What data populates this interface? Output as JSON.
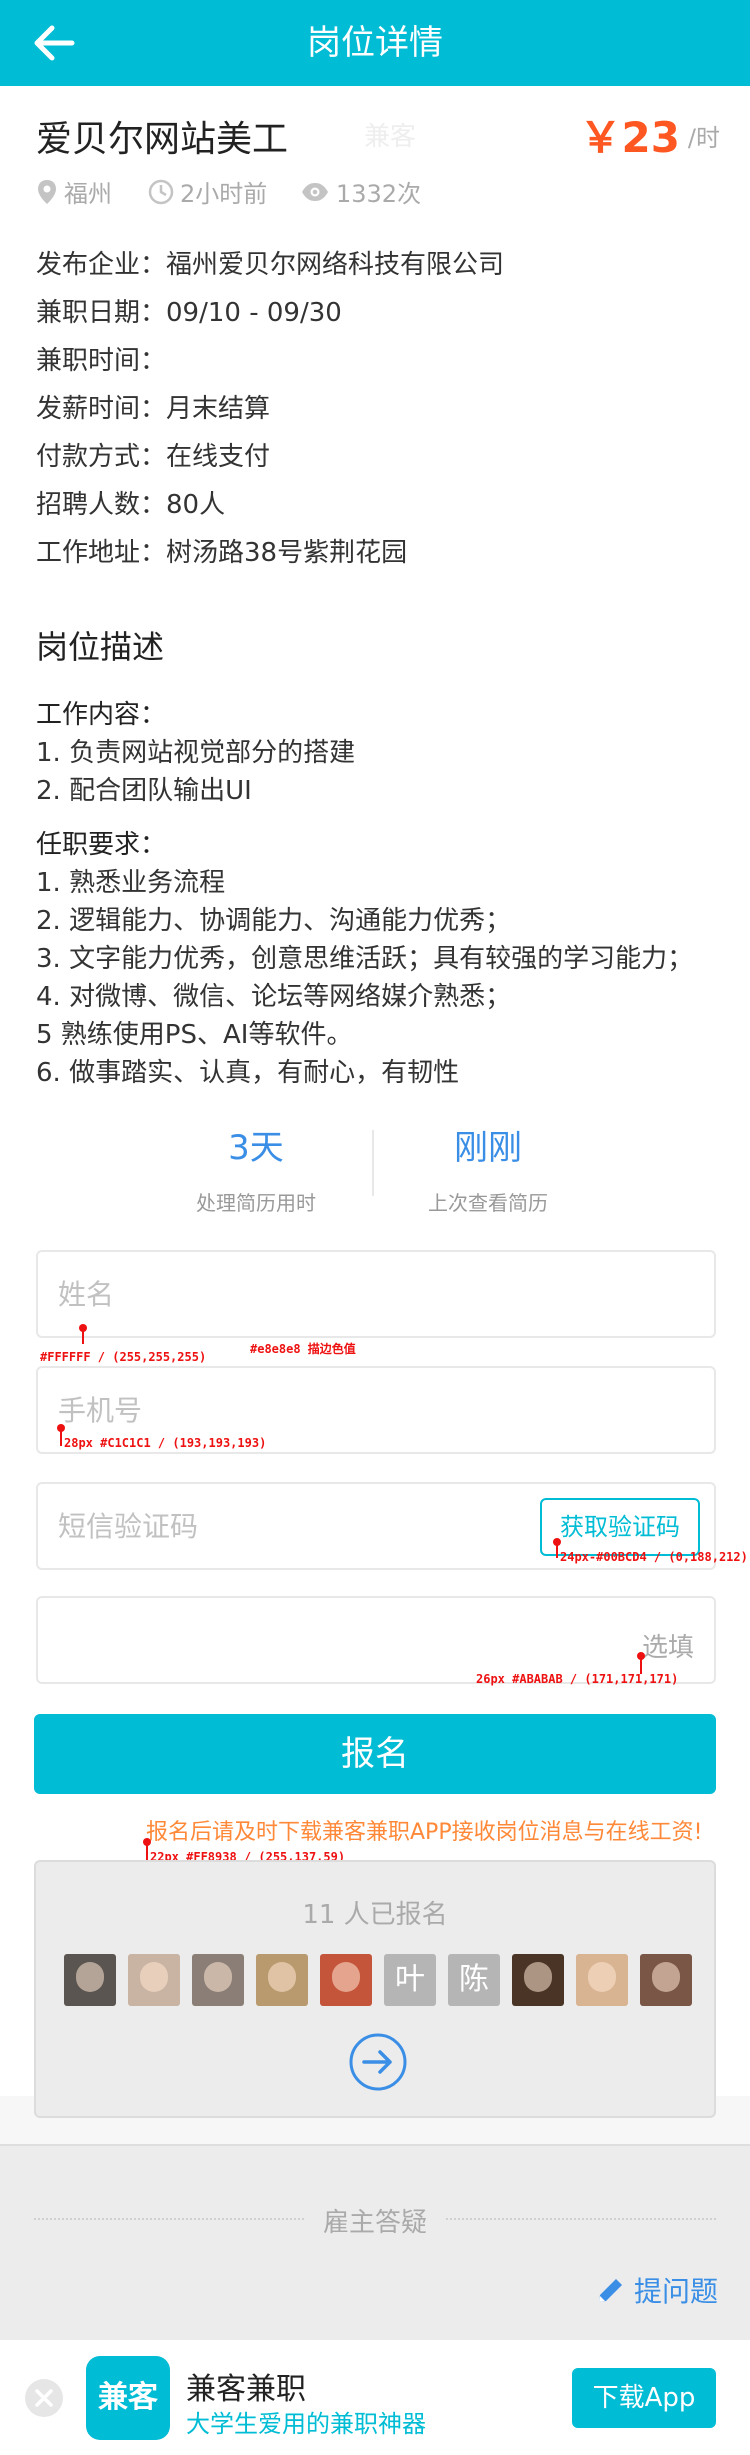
{
  "header": {
    "title": "岗位详情"
  },
  "job": {
    "title": "爱贝尔网站美工",
    "ad_tag": "兼客",
    "price": "￥23",
    "price_unit": "/时",
    "location": "福州",
    "posted": "2小时前",
    "views": "1332次",
    "fields": [
      {
        "label": "发布企业：",
        "value": "福州爱贝尔网络科技有限公司"
      },
      {
        "label": "兼职日期：",
        "value": "09/10 - 09/30"
      },
      {
        "label": "兼职时间：",
        "value": ""
      },
      {
        "label": "发薪时间：",
        "value": "月末结算"
      },
      {
        "label": "付款方式：",
        "value": "在线支付"
      },
      {
        "label": "招聘人数：",
        "value": "80人"
      },
      {
        "label": "工作地址：",
        "value": "树汤路38号紫荆花园"
      }
    ]
  },
  "description": {
    "title": "岗位描述",
    "content_head": "工作内容：",
    "content": [
      "1. 负责网站视觉部分的搭建",
      "2. 配合团队输出UI"
    ],
    "req_head": "任职要求：",
    "requirements": [
      "1. 熟悉业务流程",
      "2. 逻辑能力、协调能力、沟通能力优秀；",
      "3. 文字能力优秀，创意思维活跃；具有较强的学习能力；",
      "4. 对微博、微信、论坛等网络媒介熟悉；",
      "5 熟练使用PS、AI等软件。",
      "6. 做事踏实、认真，有耐心，有韧性"
    ]
  },
  "stats": [
    {
      "value": "3天",
      "label": "处理简历用时"
    },
    {
      "value": "刚刚",
      "label": "上次查看简历"
    }
  ],
  "form": {
    "name_placeholder": "姓名",
    "phone_placeholder": "手机号",
    "code_placeholder": "短信验证码",
    "code_button": "获取验证码",
    "optional_label": "选填",
    "submit": "报名",
    "notice": "报名后请及时下载兼客兼职APP接收岗位消息与在线工资!"
  },
  "annotations": {
    "a1": "#FFFFFF / (255,255,255)",
    "a2": "#e8e8e8  描边色值",
    "a3": "28px #C1C1C1 / (193,193,193)",
    "a4": "24px-#00BCD4 / (0,188,212)",
    "a5": "26px #ABABAB / (171,171,171)",
    "a6": "22px #FF8938 / (255,137,59)"
  },
  "applicants": {
    "count_text": "11 人已报名",
    "avatars": [
      {
        "kind": "photo",
        "color": "#5a5550"
      },
      {
        "kind": "photo",
        "color": "#c9b3a2"
      },
      {
        "kind": "photo",
        "color": "#8a7e76"
      },
      {
        "kind": "photo",
        "color": "#b89a6e"
      },
      {
        "kind": "photo",
        "color": "#c4553a"
      },
      {
        "kind": "text",
        "text": "叶"
      },
      {
        "kind": "text",
        "text": "陈"
      },
      {
        "kind": "photo",
        "color": "#4a3426"
      },
      {
        "kind": "photo",
        "color": "#d8b493"
      },
      {
        "kind": "photo",
        "color": "#7a5646"
      }
    ]
  },
  "qa": {
    "title": "雇主答疑",
    "ask": "提问题"
  },
  "banner": {
    "logo": "兼客",
    "name": "兼客兼职",
    "tagline": "大学生爱用的兼职神器",
    "download": "下载App"
  },
  "colors": {
    "accent": "#00bcd4",
    "price": "#ff5722",
    "link": "#3a8ee6",
    "notice": "#ff8938"
  }
}
